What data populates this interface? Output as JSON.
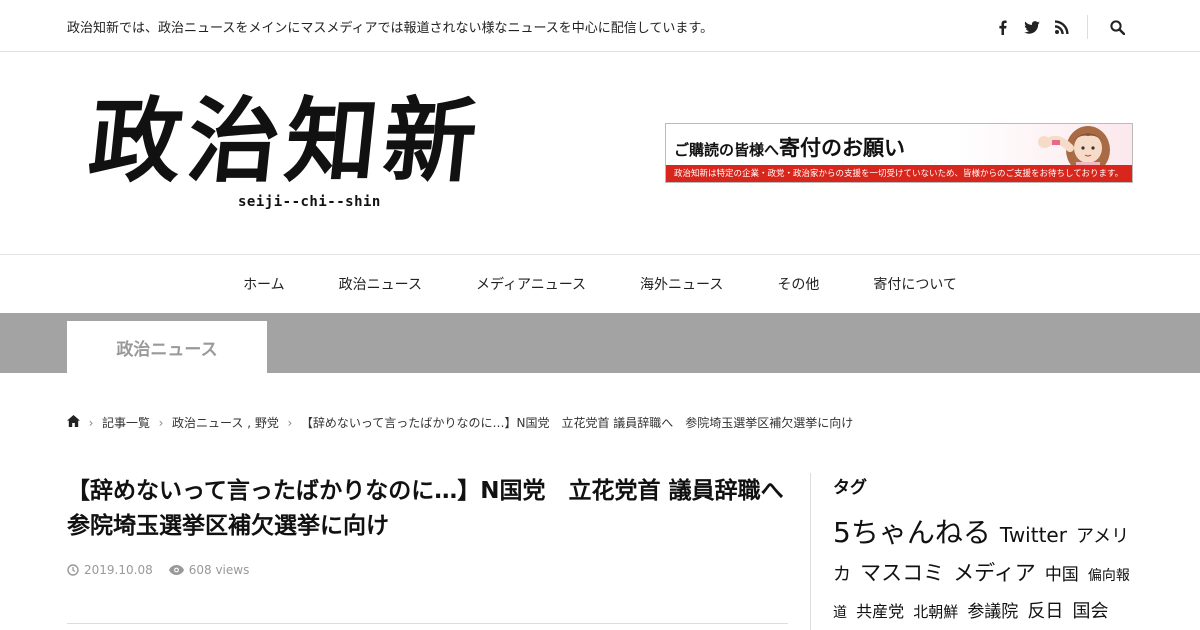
{
  "topbar": {
    "description": "政治知新では、政治ニュースをメインにマスメディアでは報道されない様なニュースを中心に配信しています。",
    "icons": [
      "facebook-icon",
      "twitter-icon",
      "rss-icon",
      "search-icon"
    ]
  },
  "header": {
    "logo_text": "政治知新",
    "logo_chars": [
      "政",
      "治",
      "知",
      "新"
    ],
    "logo_subtitle": "seiji--chi--shin",
    "banner": {
      "title_small": "ご購読の皆様へ",
      "title_big": "寄付のお願い",
      "footer_text": "政治知新は特定の企業・政党・政治家からの支援を一切受けていないため、皆様からのご支援をお待ちしております。",
      "accent_color": "#d8261c"
    }
  },
  "nav": {
    "items": [
      {
        "label": "ホーム"
      },
      {
        "label": "政治ニュース"
      },
      {
        "label": "メディアニュース"
      },
      {
        "label": "海外ニュース"
      },
      {
        "label": "その他"
      },
      {
        "label": "寄付について"
      }
    ]
  },
  "category": {
    "label": "政治ニュース",
    "band_color": "#a3a3a3"
  },
  "breadcrumb": {
    "home_icon": "home-icon",
    "items": [
      {
        "label": "記事一覧"
      },
      {
        "label": "政治ニュース , 野党"
      },
      {
        "label": "【辞めないって言ったばかりなのに…】N国党　立花党首 議員辞職へ　参院埼玉選挙区補欠選挙に向け"
      }
    ]
  },
  "article": {
    "title": "【辞めないって言ったばかりなのに…】N国党　立花党首 議員辞職へ　参院埼玉選挙区補欠選挙に向け",
    "date": "2019.10.08",
    "views": "608 views"
  },
  "sidebar": {
    "heading": "タグ",
    "tags": [
      {
        "label": "5ちゃんねる",
        "size": 28
      },
      {
        "label": "Twitter",
        "size": 20
      },
      {
        "label": "アメリカ",
        "size": 18
      },
      {
        "label": "マスコミ",
        "size": 21
      },
      {
        "label": "メディア",
        "size": 21
      },
      {
        "label": "中国",
        "size": 17
      },
      {
        "label": "偏向報道",
        "size": 14
      },
      {
        "label": "共産党",
        "size": 16
      },
      {
        "label": "北朝鮮",
        "size": 15
      },
      {
        "label": "参議院",
        "size": 17
      },
      {
        "label": "反日",
        "size": 18
      },
      {
        "label": "国会",
        "size": 18
      }
    ]
  }
}
